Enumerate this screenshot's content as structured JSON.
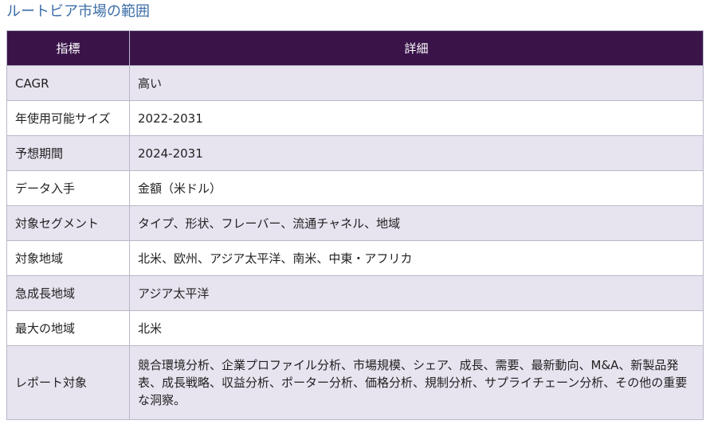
{
  "page": {
    "title": "ルートビア市場の範囲"
  },
  "table": {
    "headers": [
      "指標",
      "詳細"
    ],
    "rows": [
      {
        "key": "CAGR",
        "value": "高い"
      },
      {
        "key": "年使用可能サイズ",
        "value": "2022-2031"
      },
      {
        "key": "予想期間",
        "value": "2024-2031"
      },
      {
        "key": "データ入手",
        "value": "金額（米ドル）"
      },
      {
        "key": "対象セグメント",
        "value": "タイプ、形状、フレーバー、流通チャネル、地域"
      },
      {
        "key": "対象地域",
        "value": "北米、欧州、アジア太平洋、南米、中東・アフリカ"
      },
      {
        "key": "急成長地域",
        "value": "アジア太平洋"
      },
      {
        "key": "最大の地域",
        "value": "北米"
      },
      {
        "key": "レポート対象",
        "value": "競合環境分析、企業プロファイル分析、市場規模、シェア、成長、需要、最新動向、M&A、新製品発表、成長戦略、収益分析、ポーター分析、価格分析、規制分析、サプライチェーン分析、その他の重要な洞察。"
      }
    ]
  },
  "colors": {
    "title": "#3d6ea8",
    "header_bg": "#3a1449",
    "header_text": "#ffffff",
    "row_alt_bg": "#e7e3ef",
    "row_bg": "#ffffff",
    "border": "#b9b9c9"
  }
}
